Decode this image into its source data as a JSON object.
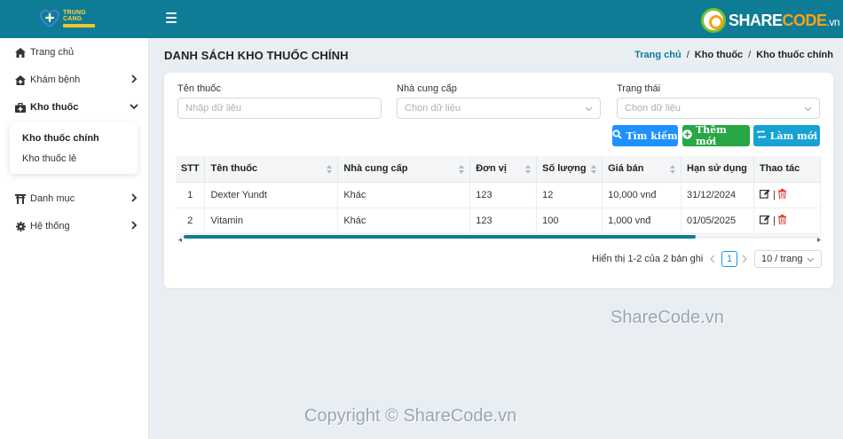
{
  "header": {
    "logo_name": "TRUNG CANG",
    "brand_name_part1": "SHARE",
    "brand_name_part2": "CODE",
    "brand_domain": ".vn"
  },
  "sidebar": {
    "items": [
      {
        "label": "Trang chủ",
        "icon": "home-icon"
      },
      {
        "label": "Khám bệnh",
        "icon": "house-medical-icon"
      },
      {
        "label": "Kho thuốc",
        "icon": "medkit-icon"
      },
      {
        "label": "Danh mục",
        "icon": "torii-icon"
      },
      {
        "label": "Hệ thống",
        "icon": "gear-icon"
      }
    ],
    "submenu": [
      "Kho thuốc chính",
      "Kho thuốc lẻ"
    ]
  },
  "page": {
    "title": "DANH SÁCH KHO THUỐC CHÍNH",
    "breadcrumb": [
      "Trang chủ",
      "Kho thuốc",
      "Kho thuốc chính"
    ],
    "separator": "/"
  },
  "filters": {
    "drug_name_label": "Tên thuốc",
    "drug_name_placeholder": "Nhập dữ liệu",
    "supplier_label": "Nhà cung cấp",
    "supplier_placeholder": "Chọn dữ liệu",
    "status_label": "Trạng thái",
    "status_placeholder": "Chọn dữ liệu"
  },
  "buttons": {
    "search": "Tìm kiếm",
    "add": "Thêm mới",
    "reset": "Làm mới"
  },
  "table": {
    "headers": [
      "STT",
      "Tên thuốc",
      "Nhà cung cấp",
      "Đơn vị",
      "Số lượng",
      "Giá bán",
      "Hạn sử dụng",
      "Thao tác"
    ],
    "rows": [
      [
        "1",
        "Dexter Yundt",
        "Khác",
        "123",
        "12",
        "10,000 vnđ",
        "31/12/2024"
      ],
      [
        "2",
        "Vitamin",
        "Khác",
        "123",
        "100",
        "1,000 vnđ",
        "01/05/2025"
      ]
    ]
  },
  "pagination": {
    "info": "Hiển thị 1-2 của 2 bản ghi",
    "current_page": "1",
    "page_size": "10 / trang"
  },
  "watermarks": {
    "mid": "ShareCode.vn",
    "bottom": "Copyright © ShareCode.vn"
  },
  "colors": {
    "header_bg": "#0e7c94",
    "primary": "#1e90ff",
    "success": "#28a745",
    "info": "#17a2d6",
    "danger": "#e53935"
  }
}
